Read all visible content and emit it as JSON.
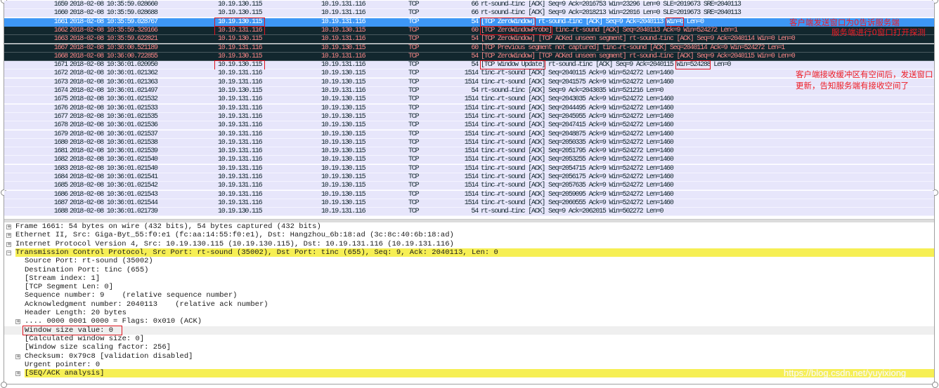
{
  "colors": {
    "row_normal": "#e7e6fb",
    "row_selected": "#3d97f6",
    "row_bad_bg": "#12272e",
    "row_bad_text": "#f78787",
    "highlight_yellow": "#f6ef54",
    "annotation_red": "#ee1c25"
  },
  "packets": [
    {
      "no": "1659",
      "time": "2018-02-08 10:35:59.028660",
      "src": "10.19.130.115",
      "dst": "10.19.131.116",
      "proto": "TCP",
      "len": "66",
      "info": "rt-sound→tinc [ACK] Seq=9 Ack=2016753 Win=23296 Len=0 SLE=2019673 SRE=2040113",
      "style": "normal"
    },
    {
      "no": "1660",
      "time": "2018-02-08 10:35:59.028688",
      "src": "10.19.130.115",
      "dst": "10.19.131.116",
      "proto": "TCP",
      "len": "66",
      "info": "rt-sound→tinc [ACK] Seq=9 Ack=2018213 Win=22016 Len=0 SLE=2019673 SRE=2040113",
      "style": "normal"
    },
    {
      "no": "1661",
      "time": "2018-02-08 10:35:59.028767",
      "src": "10.19.130.115",
      "dst": "10.19.131.116",
      "proto": "TCP",
      "len": "54",
      "info": "[TCP ZeroWindow] rt-sound→tinc [ACK] Seq=9 Ack=2040113 Win=0 Len=0",
      "style": "selected",
      "src_boxed": true,
      "boxed": [
        "[TCP ZeroWindow]",
        "Win=0"
      ]
    },
    {
      "no": "1662",
      "time": "2018-02-08 10:35:59.329166",
      "src": "10.19.131.116",
      "dst": "10.19.130.115",
      "proto": "TCP",
      "len": "60",
      "info": "[TCP ZeroWindowProbe] tinc→rt-sound [ACK] Seq=2040113 Ack=9 Win=524272 Len=1",
      "style": "bad",
      "src_boxed": true,
      "boxed": [
        "[TCP ZeroWindowProbe]"
      ]
    },
    {
      "no": "1663",
      "time": "2018-02-08 10:35:59.622821",
      "src": "10.19.130.115",
      "dst": "10.19.131.116",
      "proto": "TCP",
      "len": "54",
      "info": "[TCP ZeroWindow] [TCP ACKed unseen segment] rt-sound→tinc [ACK] Seq=9 Ack=2040114 Win=0 Len=0",
      "style": "bad"
    },
    {
      "no": "1667",
      "time": "2018-02-08 10:36:00.521189",
      "src": "10.19.131.116",
      "dst": "10.19.130.115",
      "proto": "TCP",
      "len": "60",
      "info": "[TCP Previous segment not captured] tinc→rt-sound [ACK] Seq=2040114 Ack=9 Win=524272 Len=1",
      "style": "bad"
    },
    {
      "no": "1668",
      "time": "2018-02-08 10:36:00.722855",
      "src": "10.19.130.115",
      "dst": "10.19.131.116",
      "proto": "TCP",
      "len": "54",
      "info": "[TCP ZeroWindow] [TCP ACKed unseen segment] rt-sound→tinc [ACK] Seq=9 Ack=2040115 Win=0 Len=0",
      "style": "bad"
    },
    {
      "no": "1671",
      "time": "2018-02-08 10:36:01.020950",
      "src": "10.19.130.115",
      "dst": "10.19.131.116",
      "proto": "TCP",
      "len": "54",
      "info": "[TCP Window Update] rt-sound→tinc [ACK] Seq=9 Ack=2040115 Win=524288 Len=0",
      "style": "normal",
      "src_boxed": true,
      "boxed": [
        "[TCP Window Update]",
        "Win=524288"
      ]
    },
    {
      "no": "1672",
      "time": "2018-02-08 10:36:01.021362",
      "src": "10.19.131.116",
      "dst": "10.19.130.115",
      "proto": "TCP",
      "len": "1514",
      "info": "tinc→rt-sound [ACK] Seq=2040115 Ack=9 Win=524272 Len=1460",
      "style": "normal"
    },
    {
      "no": "1673",
      "time": "2018-02-08 10:36:01.021363",
      "src": "10.19.131.116",
      "dst": "10.19.130.115",
      "proto": "TCP",
      "len": "1514",
      "info": "tinc→rt-sound [ACK] Seq=2041575 Ack=9 Win=524272 Len=1460",
      "style": "normal"
    },
    {
      "no": "1674",
      "time": "2018-02-08 10:36:01.021497",
      "src": "10.19.130.115",
      "dst": "10.19.131.116",
      "proto": "TCP",
      "len": "54",
      "info": "rt-sound→tinc [ACK] Seq=9 Ack=2043035 Win=521216 Len=0",
      "style": "normal"
    },
    {
      "no": "1675",
      "time": "2018-02-08 10:36:01.021532",
      "src": "10.19.131.116",
      "dst": "10.19.130.115",
      "proto": "TCP",
      "len": "1514",
      "info": "tinc→rt-sound [ACK] Seq=2043035 Ack=9 Win=524272 Len=1460",
      "style": "normal"
    },
    {
      "no": "1676",
      "time": "2018-02-08 10:36:01.021533",
      "src": "10.19.131.116",
      "dst": "10.19.130.115",
      "proto": "TCP",
      "len": "1514",
      "info": "tinc→rt-sound [ACK] Seq=2044495 Ack=9 Win=524272 Len=1460",
      "style": "normal"
    },
    {
      "no": "1677",
      "time": "2018-02-08 10:36:01.021535",
      "src": "10.19.131.116",
      "dst": "10.19.130.115",
      "proto": "TCP",
      "len": "1514",
      "info": "tinc→rt-sound [ACK] Seq=2045955 Ack=9 Win=524272 Len=1460",
      "style": "normal"
    },
    {
      "no": "1678",
      "time": "2018-02-08 10:36:01.021536",
      "src": "10.19.131.116",
      "dst": "10.19.130.115",
      "proto": "TCP",
      "len": "1514",
      "info": "tinc→rt-sound [ACK] Seq=2047415 Ack=9 Win=524272 Len=1460",
      "style": "normal"
    },
    {
      "no": "1679",
      "time": "2018-02-08 10:36:01.021537",
      "src": "10.19.131.116",
      "dst": "10.19.130.115",
      "proto": "TCP",
      "len": "1514",
      "info": "tinc→rt-sound [ACK] Seq=2048875 Ack=9 Win=524272 Len=1460",
      "style": "normal"
    },
    {
      "no": "1680",
      "time": "2018-02-08 10:36:01.021538",
      "src": "10.19.131.116",
      "dst": "10.19.130.115",
      "proto": "TCP",
      "len": "1514",
      "info": "tinc→rt-sound [ACK] Seq=2050335 Ack=9 Win=524272 Len=1460",
      "style": "normal"
    },
    {
      "no": "1681",
      "time": "2018-02-08 10:36:01.021539",
      "src": "10.19.131.116",
      "dst": "10.19.130.115",
      "proto": "TCP",
      "len": "1514",
      "info": "tinc→rt-sound [ACK] Seq=2051795 Ack=9 Win=524272 Len=1460",
      "style": "normal"
    },
    {
      "no": "1682",
      "time": "2018-02-08 10:36:01.021540",
      "src": "10.19.131.116",
      "dst": "10.19.130.115",
      "proto": "TCP",
      "len": "1514",
      "info": "tinc→rt-sound [ACK] Seq=2053255 Ack=9 Win=524272 Len=1460",
      "style": "normal"
    },
    {
      "no": "1683",
      "time": "2018-02-08 10:36:01.021540",
      "src": "10.19.131.116",
      "dst": "10.19.130.115",
      "proto": "TCP",
      "len": "1514",
      "info": "tinc→rt-sound [ACK] Seq=2054715 Ack=9 Win=524272 Len=1460",
      "style": "normal"
    },
    {
      "no": "1684",
      "time": "2018-02-08 10:36:01.021541",
      "src": "10.19.131.116",
      "dst": "10.19.130.115",
      "proto": "TCP",
      "len": "1514",
      "info": "tinc→rt-sound [ACK] Seq=2056175 Ack=9 Win=524272 Len=1460",
      "style": "normal"
    },
    {
      "no": "1685",
      "time": "2018-02-08 10:36:01.021542",
      "src": "10.19.131.116",
      "dst": "10.19.130.115",
      "proto": "TCP",
      "len": "1514",
      "info": "tinc→rt-sound [ACK] Seq=2057635 Ack=9 Win=524272 Len=1460",
      "style": "normal"
    },
    {
      "no": "1686",
      "time": "2018-02-08 10:36:01.021543",
      "src": "10.19.131.116",
      "dst": "10.19.130.115",
      "proto": "TCP",
      "len": "1514",
      "info": "tinc→rt-sound [ACK] Seq=2059095 Ack=9 Win=524272 Len=1460",
      "style": "normal"
    },
    {
      "no": "1687",
      "time": "2018-02-08 10:36:01.021544",
      "src": "10.19.131.116",
      "dst": "10.19.130.115",
      "proto": "TCP",
      "len": "1514",
      "info": "tinc→rt-sound [ACK] Seq=2060555 Ack=9 Win=524272 Len=1460",
      "style": "normal"
    },
    {
      "no": "1688",
      "time": "2018-02-08 10:36:01.021739",
      "src": "10.19.130.115",
      "dst": "10.19.131.116",
      "proto": "TCP",
      "len": "54",
      "info": "rt-sound→tinc [ACK] Seq=9 Ack=2062015 Win=502272 Len=0",
      "style": "normal"
    }
  ],
  "details": [
    {
      "text": "Frame 1661: 54 bytes on wire (432 bits), 54 bytes captured (432 bits)",
      "level": 0,
      "expander": "+"
    },
    {
      "text": "Ethernet II, Src: Giga-Byt_55:f0:e1 (fc:aa:14:55:f0:e1), Dst: Hangzhou_6b:18:ad (3c:8c:40:6b:18:ad)",
      "level": 0,
      "expander": "+"
    },
    {
      "text": "Internet Protocol Version 4, Src: 10.19.130.115 (10.19.130.115), Dst: 10.19.131.116 (10.19.131.116)",
      "level": 0,
      "expander": "+"
    },
    {
      "text": "Transmission Control Protocol, Src Port: rt-sound (35002), Dst Port: tinc (655), Seq: 9, Ack: 2040113, Len: 0",
      "level": 0,
      "expander": "−",
      "highlight": true
    },
    {
      "text": "Source Port: rt-sound (35002)",
      "level": 1
    },
    {
      "text": "Destination Port: tinc (655)",
      "level": 1
    },
    {
      "text": "[Stream index: 1]",
      "level": 1
    },
    {
      "text": "[TCP Segment Len: 0]",
      "level": 1
    },
    {
      "text": "Sequence number: 9    (relative sequence number)",
      "level": 1
    },
    {
      "text": "Acknowledgment number: 2040113    (relative ack number)",
      "level": 1
    },
    {
      "text": "Header Length: 20 bytes",
      "level": 1
    },
    {
      "text": ".... 0000 0001 0000 = Flags: 0x010 (ACK)",
      "level": 1,
      "expander": "+"
    },
    {
      "text": "Window size value: 0",
      "level": 1,
      "boxed": true,
      "selected_gray": true
    },
    {
      "text": "[Calculated window size: 0]",
      "level": 1
    },
    {
      "text": "[Window size scaling factor: 256]",
      "level": 1
    },
    {
      "text": "Checksum: 0x79c8 [validation disabled]",
      "level": 1,
      "expander": "+"
    },
    {
      "text": "Urgent pointer: 0",
      "level": 1
    },
    {
      "text": "[SEQ/ACK analysis]",
      "level": 1,
      "expander": "+",
      "highlight": true
    }
  ],
  "annotations": {
    "zero_window": "客户端发送窗口为0告诉服务端",
    "probe": "服务端进行0窗口打开探测",
    "update_line1": "客户端接收缓冲区有空间后，发送窗口",
    "update_line2": "更新，告知服务端有接收空间了"
  },
  "watermark": "https://blog.csdn.net/yuyixiong"
}
